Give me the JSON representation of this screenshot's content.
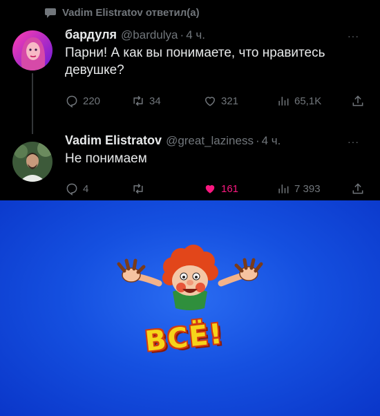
{
  "reply_header": {
    "text": "Vadim Elistratov ответил(а)"
  },
  "tweets": [
    {
      "name": "бардуля",
      "handle": "@bardulya",
      "separator": "·",
      "time": "4 ч.",
      "text": "Парни! А как вы понимаете, что нравитесь девушке?",
      "more": "···",
      "replies": "220",
      "retweets": "34",
      "likes": "321",
      "views": "65,1K",
      "liked": false
    },
    {
      "name": "Vadim Elistratov",
      "handle": "@great_laziness",
      "separator": "·",
      "time": "4 ч.",
      "text": "Не понимаем",
      "more": "···",
      "replies": "4",
      "retweets": "",
      "likes": "161",
      "views": "7 393",
      "liked": true
    }
  ],
  "meme": {
    "caption": "ВСЁ!"
  },
  "colors": {
    "background": "#000000",
    "muted": "#71767b",
    "text": "#e7e9ea",
    "like": "#f91880",
    "meme_blue": "#1550e0"
  }
}
